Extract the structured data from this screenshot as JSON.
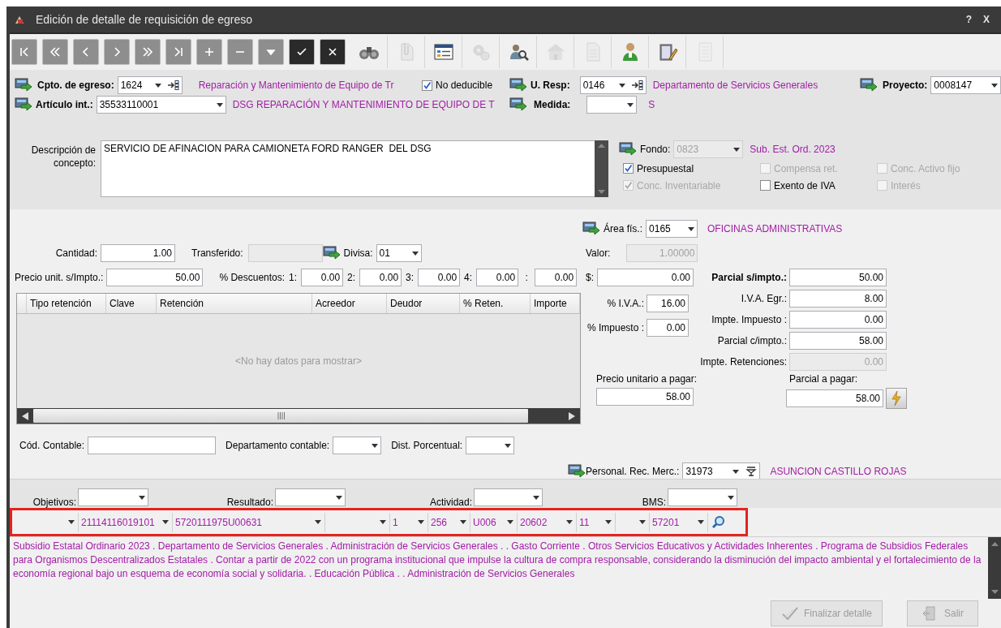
{
  "window": {
    "title": "Edición de detalle de requisición de egreso",
    "help": "?",
    "close": "X"
  },
  "toolbar": [
    {
      "kind": "first",
      "disabled": true
    },
    {
      "kind": "prev-page",
      "disabled": true
    },
    {
      "kind": "prev",
      "disabled": true
    },
    {
      "kind": "next",
      "disabled": true
    },
    {
      "kind": "next-page",
      "disabled": true
    },
    {
      "kind": "last",
      "disabled": true
    },
    {
      "kind": "add",
      "disabled": true
    },
    {
      "kind": "remove",
      "disabled": true
    },
    {
      "kind": "down",
      "disabled": true
    },
    {
      "kind": "accept",
      "disabled": false
    },
    {
      "kind": "cancel",
      "disabled": false
    },
    {
      "kind": "find",
      "disabled": false
    },
    {
      "kind": "attach",
      "disabled": true
    },
    {
      "kind": "form",
      "disabled": false
    },
    {
      "kind": "config",
      "disabled": true
    },
    {
      "kind": "lookup",
      "disabled": false
    },
    {
      "kind": "house",
      "disabled": true
    },
    {
      "kind": "document",
      "disabled": true
    },
    {
      "kind": "user",
      "disabled": false
    },
    {
      "kind": "book",
      "disabled": false
    },
    {
      "kind": "list",
      "disabled": true
    }
  ],
  "header": {
    "cpto": {
      "label": "Cpto. de egreso:",
      "value": "1624",
      "description": "Reparación y Mantenimiento de Equipo de Tr"
    },
    "no_deducible": {
      "label": "No deducible",
      "checked": true
    },
    "u_resp": {
      "label": "U. Resp:",
      "value": "0146",
      "description": "Departamento de Servicios Generales"
    },
    "proyecto": {
      "label": "Proyecto:",
      "value": "0008147"
    },
    "articulo": {
      "label": "Artículo int.:",
      "value": "35533110001",
      "description": "DSG REPARACIÓN Y MANTENIMIENTO DE EQUIPO DE T"
    },
    "medida": {
      "label": "Medida:",
      "description": "S"
    },
    "descripcion": {
      "label": "Descripción de concepto:",
      "value": "SERVICIO DE AFINACION PARA CAMIONETA FORD RANGER  DEL DSG"
    },
    "fondo": {
      "label": "Fondo:",
      "value": "0823",
      "disabled": true,
      "description": "Sub. Est. Ord. 2023"
    },
    "checks": [
      {
        "label": "Presupuestal",
        "checked": true,
        "disabled": false
      },
      {
        "label": "Compensa ret.",
        "checked": false,
        "disabled": true
      },
      {
        "label": "Conc. Activo fijo",
        "checked": false,
        "disabled": true
      },
      {
        "label": "Conc. Inventariable",
        "checked": true,
        "disabled": true
      },
      {
        "label": "Exento de IVA",
        "checked": false,
        "disabled": false
      },
      {
        "label": "Interés",
        "checked": false,
        "disabled": true
      }
    ]
  },
  "importes": {
    "area_fis": {
      "label": "Área fís.:",
      "value": "0165",
      "description": "OFICINAS ADMINISTRATIVAS"
    },
    "cantidad": {
      "label": "Cantidad:",
      "value": "1.00"
    },
    "transferido": {
      "label": "Transferido:",
      "disabled": true
    },
    "divisa": {
      "label": "Divisa:",
      "value": "01"
    },
    "valor": {
      "label": "Valor:",
      "value": "1.00000",
      "disabled": true
    },
    "precio_unit": {
      "label": "Precio unit. s/Impto.:",
      "value": "50.00"
    },
    "descuentos_label": "% Descuentos:",
    "descuentos": [
      {
        "label": "1:",
        "value": "0.00"
      },
      {
        "label": "2:",
        "value": "0.00"
      },
      {
        "label": "3:",
        "value": "0.00"
      },
      {
        "label": "4:",
        "value": "0.00"
      },
      {
        "label": ":",
        "value": "0.00"
      }
    ],
    "monto": {
      "label": "$:",
      "value": "0.00"
    },
    "iva_pct": {
      "label": "% I.V.A.:",
      "value": "16.00"
    },
    "impuesto_pct": {
      "label": "% Impuesto :",
      "value": "0.00"
    },
    "totals": [
      {
        "label": "Parcial s/impto.:",
        "value": "50.00",
        "bold": true,
        "disabled": false
      },
      {
        "label": "I.V.A. Egr.:",
        "value": "8.00",
        "bold": false,
        "disabled": false
      },
      {
        "label": "Impte. Impuesto :",
        "value": "0.00",
        "bold": false,
        "disabled": false
      },
      {
        "label": "Parcial c/impto.:",
        "value": "58.00",
        "bold": false,
        "disabled": false
      },
      {
        "label": "Impte. Retenciones:",
        "value": "0.00",
        "bold": false,
        "disabled": true
      }
    ],
    "precio_pagar": {
      "label": "Precio unitario a pagar:",
      "value": "58.00"
    },
    "parcial_pagar": {
      "label": "Parcial a pagar:",
      "value": "58.00"
    }
  },
  "retenciones": {
    "columns": [
      "Tipo retención",
      "Clave",
      "Retención",
      "Acreedor",
      "Deudor",
      "% Reten.",
      "Importe"
    ],
    "empty_text": "<No hay datos para mostrar>"
  },
  "contable": [
    {
      "label": "Cód. Contable:",
      "kind": "text"
    },
    {
      "label": "Departamento contable:",
      "kind": "dropdown"
    },
    {
      "label": "Dist. Porcentual:",
      "kind": "dropdown"
    }
  ],
  "personal": {
    "label": "Personal. Rec. Merc.:",
    "value": "31973",
    "description": "ASUNCION CASTILLO ROJAS"
  },
  "clasificacion": [
    {
      "label": "Objetivos:"
    },
    {
      "label": "Resultado:"
    },
    {
      "label": "Actividad:"
    },
    {
      "label": "BMS:"
    }
  ],
  "segmentos": [
    {
      "kind": "dropdown"
    },
    {
      "kind": "dropdown",
      "value": "21114116019101"
    },
    {
      "kind": "dropdown",
      "value": "5720111975U00631"
    },
    {
      "kind": "dropdown"
    },
    {
      "kind": "dropdown",
      "value": "1"
    },
    {
      "kind": "dropdown",
      "value": "256"
    },
    {
      "kind": "dropdown",
      "value": "U006"
    },
    {
      "kind": "dropdown",
      "value": "20602"
    },
    {
      "kind": "dropdown",
      "value": "11"
    },
    {
      "kind": "dropdown"
    },
    {
      "kind": "dropdown",
      "value": "57201"
    }
  ],
  "info_text": "Subsidio Estatal Ordinario 2023 . Departamento de Servicios Generales . Administración de Servicios Generales .  . Gasto Corriente . Otros Servicios Educativos y Actividades Inherentes . Programa de Subsidios Federales para Organismos Descentralizados Estatales . Contar a partir de 2022 con un programa institucional que impulse la cultura de compra responsable, considerando la disminución del impacto ambiental y el fortalecimiento de la economía regional bajo un esquema de economía social y solidaria. . Educación Pública .  . Administración de Servicios Generales",
  "buttons": [
    {
      "label": "Finalizar detalle",
      "kind": "finish",
      "disabled": true
    },
    {
      "label": "Salir",
      "kind": "exit",
      "disabled": true
    }
  ]
}
